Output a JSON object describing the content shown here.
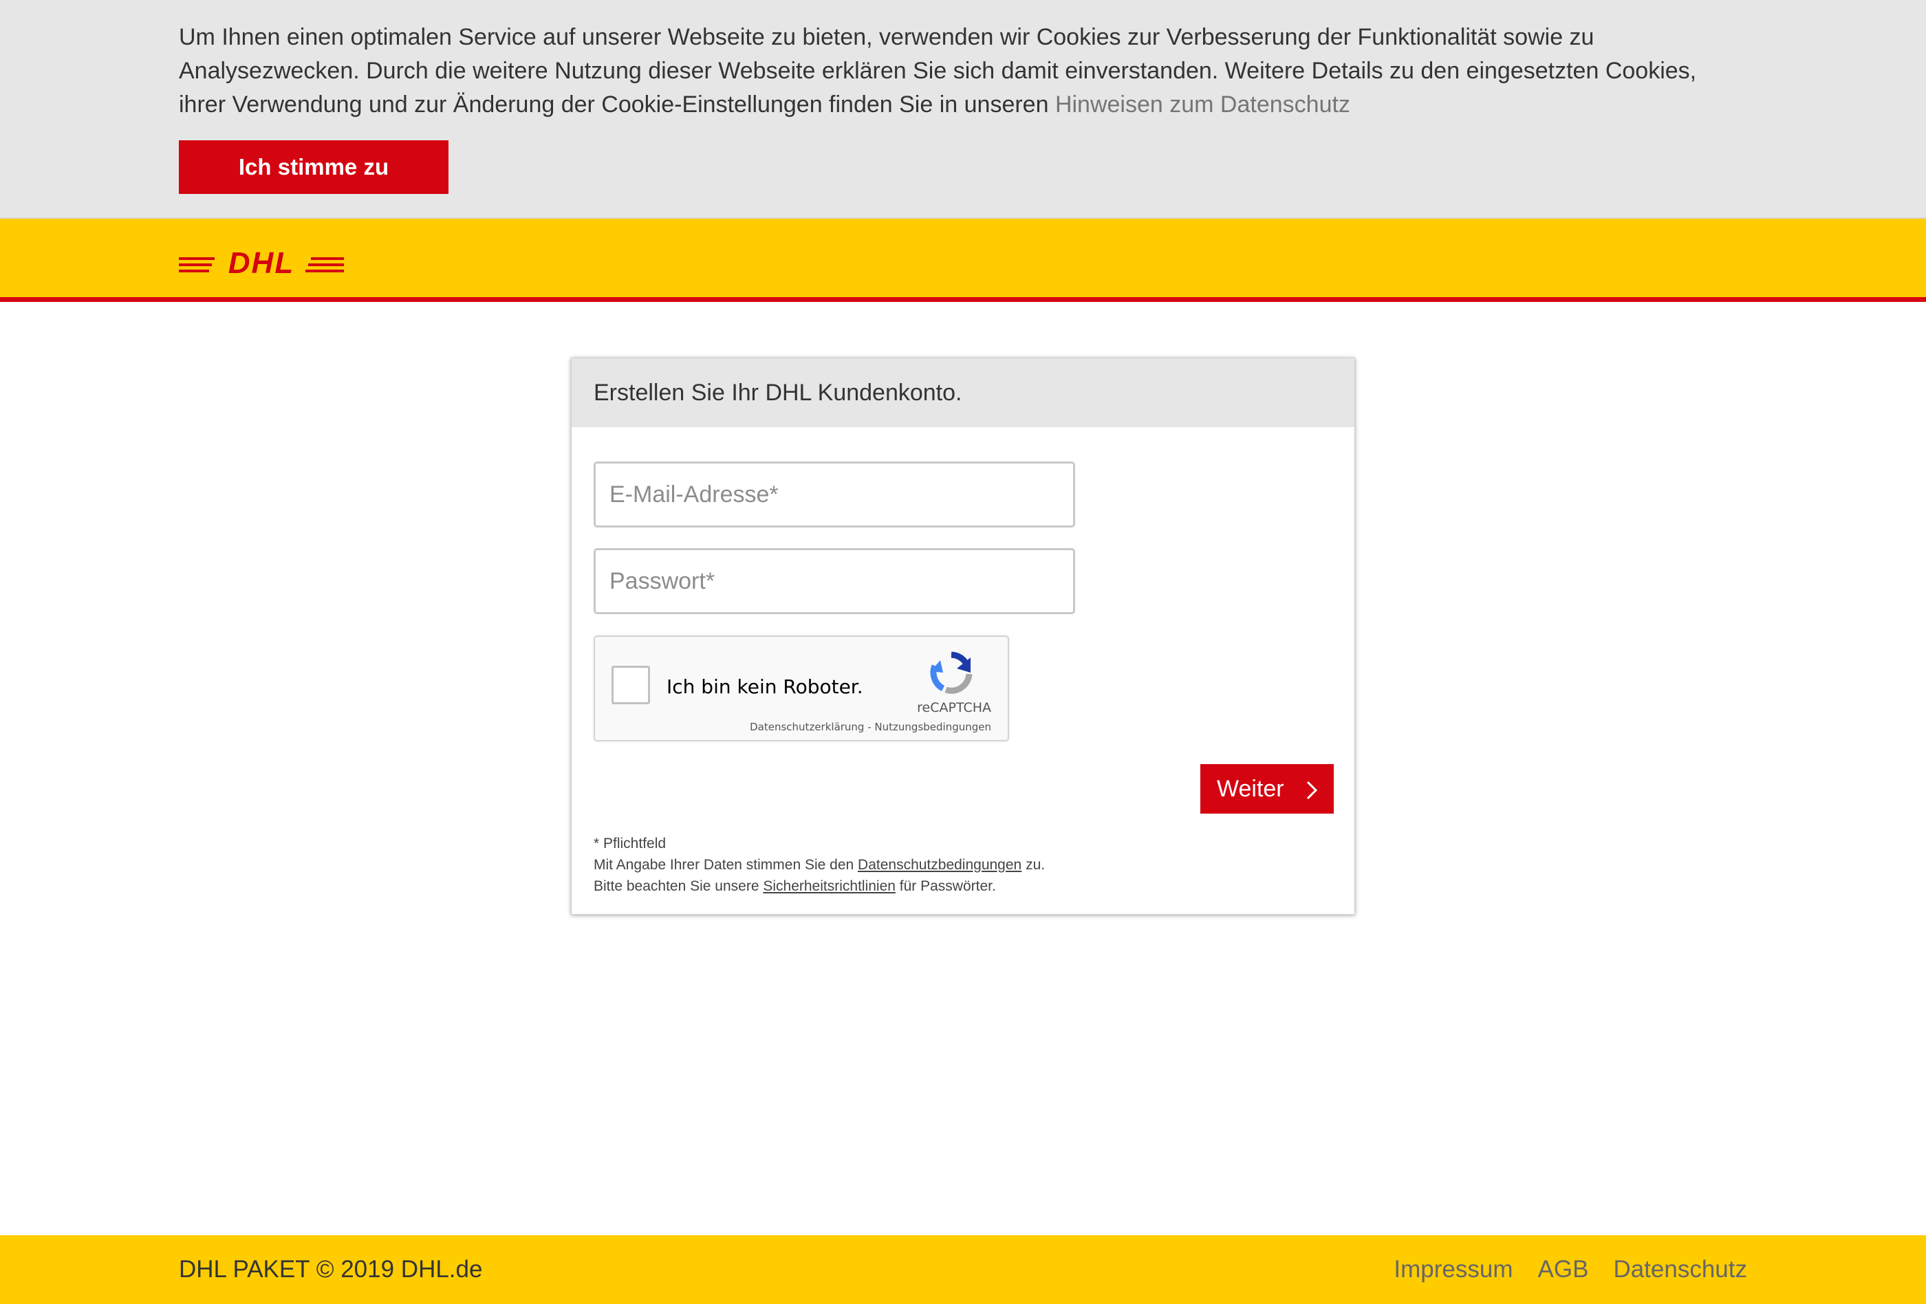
{
  "cookie_banner": {
    "text": "Um Ihnen einen optimalen Service auf unserer Webseite zu bieten, verwenden wir Cookies zur Verbesserung der Funktionalität sowie zu Analysezwecken. Durch die weitere Nutzung dieser Webseite erklären Sie sich damit einverstanden. Weitere Details zu den eingesetzten Cookies, ihrer Verwendung und zur Änderung der Cookie-Einstellungen finden Sie in unseren",
    "link_label": "Hinweisen zum Datenschutz",
    "accept_label": "Ich stimme zu"
  },
  "header": {
    "logo_text": "DHL"
  },
  "card": {
    "title": "Erstellen Sie Ihr DHL Kundenkonto.",
    "email_placeholder": "E-Mail-Adresse*",
    "password_placeholder": "Passwort*",
    "captcha": {
      "label": "Ich bin kein Roboter.",
      "brand": "reCAPTCHA",
      "privacy_label": "Datenschutzerklärung",
      "separator": " - ",
      "terms_label": "Nutzungsbedingungen"
    },
    "next_label": "Weiter",
    "notes": {
      "required": "* Pflichtfeld",
      "line2_prefix": "Mit Angabe Ihrer Daten stimmen Sie den ",
      "line2_link": "Datenschutzbedingungen",
      "line2_suffix": " zu.",
      "line3_prefix": "Bitte beachten Sie unsere ",
      "line3_link": "Sicherheitsrichtlinien",
      "line3_suffix": " für Passwörter."
    }
  },
  "footer": {
    "copyright": "DHL PAKET © 2019 DHL.de",
    "links": [
      "Impressum",
      "AGB",
      "Datenschutz"
    ]
  },
  "colors": {
    "dhl_yellow": "#ffcc00",
    "dhl_red": "#d40511",
    "banner_gray": "#e6e6e6"
  },
  "icons": {
    "logo": "dhl-logo",
    "captcha": "recaptcha-logo-icon",
    "next": "chevron-right-icon"
  }
}
